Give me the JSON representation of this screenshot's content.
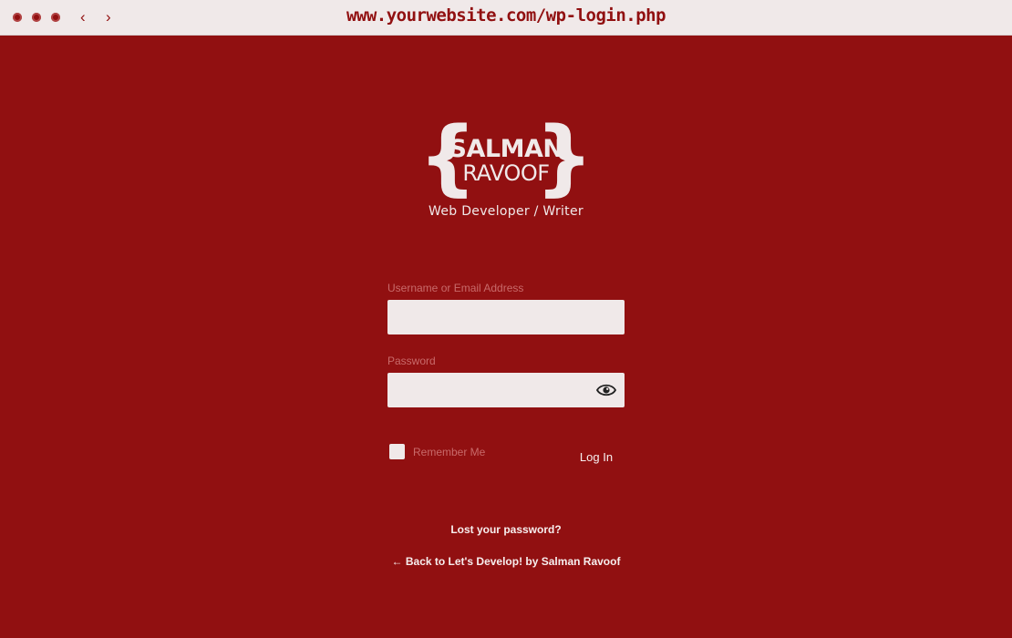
{
  "browser": {
    "url": "www.yourwebsite.com/wp-login.php",
    "back_glyph": "‹",
    "forward_glyph": "›"
  },
  "logo": {
    "text": "SALMAN RAVOOF",
    "tagline": "Web Developer / Writer"
  },
  "form": {
    "username_label": "Username or Email Address",
    "username_value": "",
    "password_label": "Password",
    "password_value": "",
    "remember_label": "Remember Me",
    "remember_checked": false,
    "login_label": "Log In"
  },
  "links": {
    "lost_password": "Lost your password?",
    "back_to_site": "← Back to Let's Develop! by Salman Ravoof"
  },
  "colors": {
    "background": "#911011",
    "foreground": "#f0e9e9",
    "label": "#c86a6a"
  },
  "icons": {
    "show_password": "eye-icon"
  }
}
